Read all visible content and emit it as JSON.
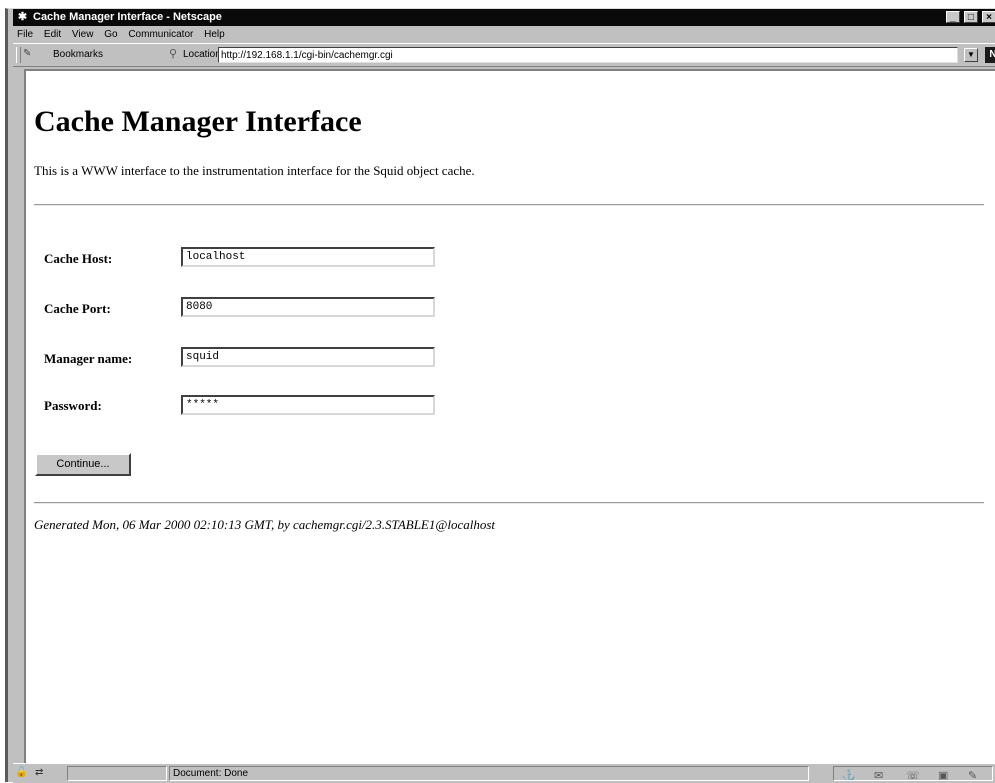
{
  "window": {
    "title": "Cache Manager Interface - Netscape",
    "controls": {
      "minimize": "_",
      "maximize": "□",
      "close": "×"
    }
  },
  "menu": [
    "File",
    "Edit",
    "View",
    "Go",
    "Communicator",
    "Help"
  ],
  "toolbar": {
    "bookmarks_label": "Bookmarks",
    "location_label": "Location:",
    "url": "http://192.168.1.1/cgi-bin/cachemgr.cgi",
    "logo": "N"
  },
  "page": {
    "title": "Cache Manager Interface",
    "intro": "This is a WWW interface to the instrumentation interface for the Squid object cache.",
    "form": {
      "host_label": "Cache Host:",
      "host_value": "localhost",
      "port_label": "Cache Port:",
      "port_value": "8080",
      "manager_label": "Manager name:",
      "manager_value": "squid",
      "password_label": "Password:",
      "password_value": "*****",
      "submit_label": "Continue..."
    },
    "footer": "Generated Mon, 06 Mar 2000 02:10:13 GMT, by cachemgr.cgi/2.3.STABLE1@localhost"
  },
  "status": {
    "text": "Document: Done"
  },
  "icons": {
    "app": "netscape-logo-icon",
    "bookmarks": "bookmark-icon",
    "location": "location-icon",
    "dropdown": "dropdown-arrow-icon",
    "security": "security-lock-icon",
    "connection": "connection-icon"
  }
}
